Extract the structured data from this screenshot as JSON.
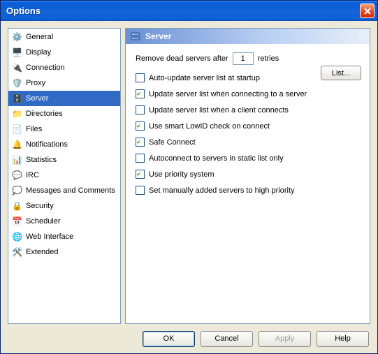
{
  "window": {
    "title": "Options"
  },
  "sidebar": {
    "items": [
      {
        "label": "General",
        "icon": "⚙️",
        "name": "sidebar-item-general"
      },
      {
        "label": "Display",
        "icon": "🖥️",
        "name": "sidebar-item-display"
      },
      {
        "label": "Connection",
        "icon": "🔌",
        "name": "sidebar-item-connection"
      },
      {
        "label": "Proxy",
        "icon": "🛡️",
        "name": "sidebar-item-proxy"
      },
      {
        "label": "Server",
        "icon": "🗄️",
        "name": "sidebar-item-server",
        "selected": true
      },
      {
        "label": "Directories",
        "icon": "📁",
        "name": "sidebar-item-directories"
      },
      {
        "label": "Files",
        "icon": "📄",
        "name": "sidebar-item-files"
      },
      {
        "label": "Notifications",
        "icon": "🔔",
        "name": "sidebar-item-notifications"
      },
      {
        "label": "Statistics",
        "icon": "📊",
        "name": "sidebar-item-statistics"
      },
      {
        "label": "IRC",
        "icon": "💬",
        "name": "sidebar-item-irc"
      },
      {
        "label": "Messages and Comments",
        "icon": "💭",
        "name": "sidebar-item-messages"
      },
      {
        "label": "Security",
        "icon": "🔒",
        "name": "sidebar-item-security"
      },
      {
        "label": "Scheduler",
        "icon": "📅",
        "name": "sidebar-item-scheduler"
      },
      {
        "label": "Web Interface",
        "icon": "🌐",
        "name": "sidebar-item-web"
      },
      {
        "label": "Extended",
        "icon": "🛠️",
        "name": "sidebar-item-extended"
      }
    ]
  },
  "panel": {
    "title": "Server",
    "line1_pre": "Remove dead servers after",
    "line1_value": "1",
    "line1_post": "retries",
    "list_button": "List...",
    "options": [
      {
        "label": "Auto-update server list at startup",
        "checked": false,
        "name": "opt-auto-update-startup"
      },
      {
        "label": "Update server list when connecting to a server",
        "checked": true,
        "name": "opt-update-on-connect"
      },
      {
        "label": "Update server list when a client connects",
        "checked": false,
        "name": "opt-update-on-client"
      },
      {
        "label": "Use smart LowID check on connect",
        "checked": true,
        "name": "opt-smart-lowid"
      },
      {
        "label": "Safe Connect",
        "checked": true,
        "name": "opt-safe-connect"
      },
      {
        "label": "Autoconnect to servers in static list only",
        "checked": false,
        "name": "opt-static-only"
      },
      {
        "label": "Use priority system",
        "checked": true,
        "name": "opt-priority-system"
      },
      {
        "label": "Set manually added servers to high priority",
        "checked": false,
        "name": "opt-manual-high-prio"
      }
    ]
  },
  "buttons": {
    "ok": "OK",
    "cancel": "Cancel",
    "apply": "Apply",
    "help": "Help"
  }
}
